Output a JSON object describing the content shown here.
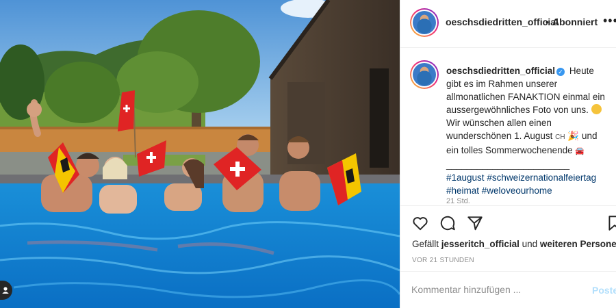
{
  "post": {
    "username": "oeschsdiedritten_official",
    "follow_status": "Abonniert",
    "separator": "•",
    "more_icon": "more-horizontal-icon"
  },
  "caption": {
    "username": "oeschsdiedritten_official",
    "verified_mark": "✓",
    "line_1": "Heute gibt es im Rahmen unserer allmonatlichen FANAKTION einmal ein aussergewöhnliches Foto von uns.",
    "line_2": "Wir wünschen allen einen wunderschönen 1. August",
    "flag_text": "CH",
    "line_3": "und ein tolles Sommerwochenende",
    "separator_line": "________________________",
    "hashtag_1": "#1august",
    "hashtag_2": "#schweizernationalfeiertag",
    "hashtag_3": "#heimat",
    "hashtag_4": "#weloveourhome",
    "time_ago": "21 Std."
  },
  "actions": {
    "icons": [
      "heart-icon",
      "comment-icon",
      "share-icon",
      "bookmark-icon"
    ],
    "likes_prefix": "Gefällt",
    "liked_by": "jesseritch_official",
    "likes_mid": "und",
    "likes_rest": "weiteren Personen",
    "timestamp": "VOR 21 STUNDEN"
  },
  "comment": {
    "placeholder": "Kommentar hinzufügen ...",
    "post_label": "Posten"
  },
  "colors": {
    "link": "#00376b",
    "verified": "#3897f0",
    "muted": "#8e8e8e",
    "post_disabled": "#b2dffc"
  }
}
